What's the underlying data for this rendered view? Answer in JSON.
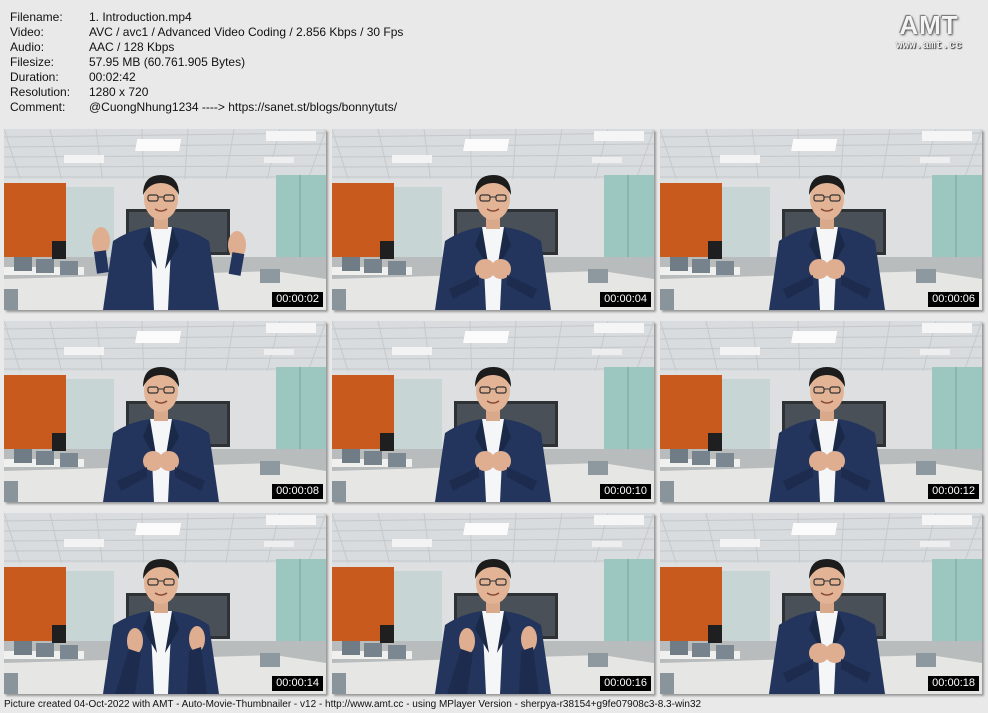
{
  "info": {
    "rows": [
      {
        "key": "Filename:",
        "value": "1. Introduction.mp4"
      },
      {
        "key": "Video:",
        "value": "AVC / avc1 / Advanced Video Coding / 2.856 Kbps / 30 Fps"
      },
      {
        "key": "Audio:",
        "value": "AAC / 128 Kbps"
      },
      {
        "key": "Filesize:",
        "value": "57.95 MB (60.761.905 Bytes)"
      },
      {
        "key": "Duration:",
        "value": "00:02:42"
      },
      {
        "key": "Resolution:",
        "value": "1280 x 720"
      },
      {
        "key": "Comment:",
        "value": "@CuongNhung1234 ----> https://sanet.st/blogs/bonnytuts/"
      }
    ]
  },
  "logo": {
    "mark": "AMT",
    "url": "www.amt.cc"
  },
  "thumbnails": [
    {
      "timestamp": "00:00:02",
      "pose": "hands-raised"
    },
    {
      "timestamp": "00:00:04",
      "pose": "hands-together"
    },
    {
      "timestamp": "00:00:06",
      "pose": "hands-together"
    },
    {
      "timestamp": "00:00:08",
      "pose": "hands-together"
    },
    {
      "timestamp": "00:00:10",
      "pose": "hands-together"
    },
    {
      "timestamp": "00:00:12",
      "pose": "hands-together"
    },
    {
      "timestamp": "00:00:14",
      "pose": "hands-apart"
    },
    {
      "timestamp": "00:00:16",
      "pose": "hands-apart"
    },
    {
      "timestamp": "00:00:18",
      "pose": "hands-together"
    }
  ],
  "footer": "Picture created 04-Oct-2022 with AMT - Auto-Movie-Thumbnailer - v12 - http://www.amt.cc - using MPlayer Version - sherpya-r38154+g9fe07908c3-8.3-win32",
  "colors": {
    "background": "#e9e9e9",
    "wall_orange": "#c85a1e",
    "wall_glass": "#9cc6c0",
    "suit_navy": "#23355c"
  }
}
